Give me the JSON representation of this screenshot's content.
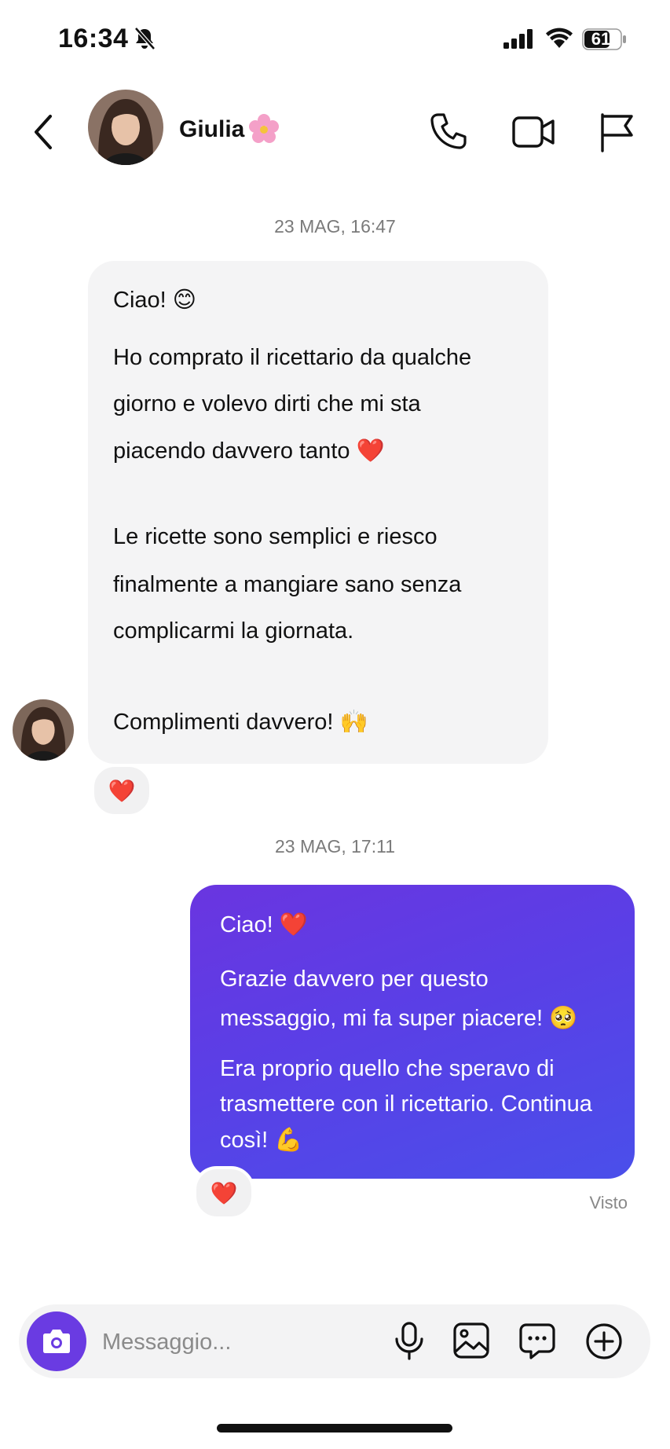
{
  "status": {
    "time": "16:34",
    "battery": "61"
  },
  "contact": {
    "name": "Giulia"
  },
  "conversation": {
    "timestamp_1": "23 MAG, 16:47",
    "incoming_lines": [
      "Ciao! 😊",
      "Ho comprato il ricettario da qualche",
      "giorno e volevo dirti che mi sta",
      "piacendo davvero tanto ❤️",
      "Le ricette sono semplici e riesco",
      "finalmente a mangiare sano senza",
      "complicarmi la giornata.",
      "Complimenti davvero! 🙌"
    ],
    "reaction_1": "❤️",
    "timestamp_2": "23 MAG, 17:11",
    "outgoing_lines": [
      "Ciao! ❤️",
      "Grazie davvero per questo",
      "messaggio, mi fa super piacere! 🥺",
      "Era proprio quello che speravo di",
      "trasmettere con il ricettario. Continua",
      "così! 💪"
    ],
    "reaction_2": "❤️",
    "seen": "Visto"
  },
  "composer": {
    "placeholder": "Messaggio..."
  },
  "icons": {
    "status": [
      "bell-off-icon",
      "signal-icon",
      "wifi-icon",
      "battery-icon"
    ],
    "header": [
      "back-icon",
      "flower-icon",
      "phone-icon",
      "video-icon",
      "flag-icon"
    ],
    "composer": [
      "camera-icon",
      "mic-icon",
      "gallery-icon",
      "sticker-icon",
      "plus-icon"
    ]
  },
  "colors": {
    "accent": "#6a3be2",
    "outgoing_start": "#6a35e0",
    "outgoing_end": "#4a4fea",
    "incoming_bg": "#f4f4f5"
  }
}
